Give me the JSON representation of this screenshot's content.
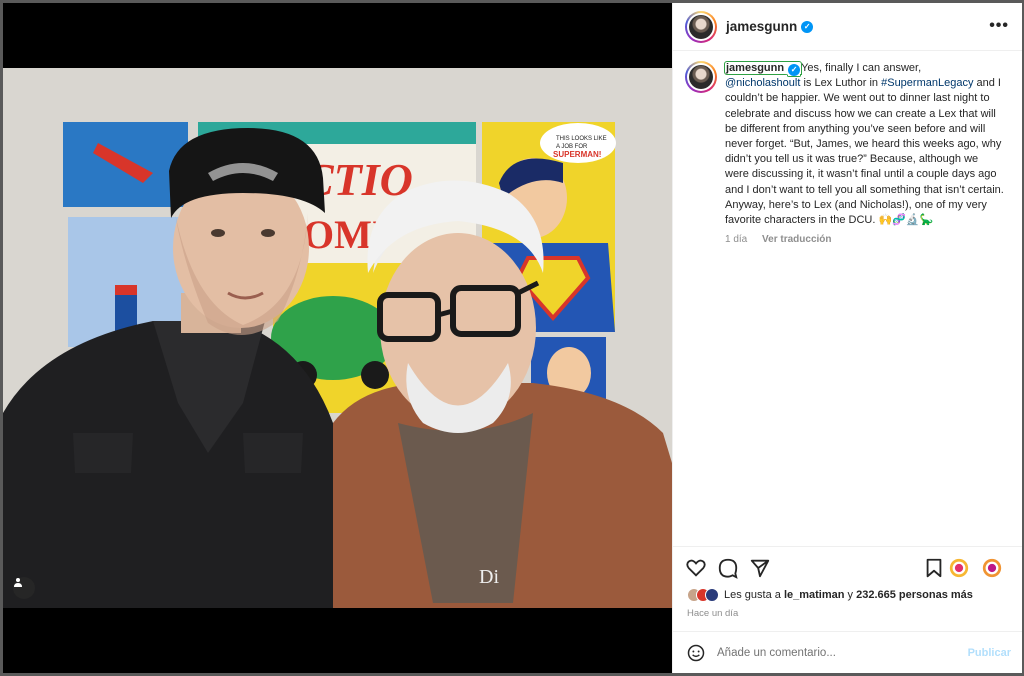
{
  "post": {
    "username": "jamesgunn",
    "verified_badge": "✓",
    "more_icon": "•••",
    "photo_letters": "Di"
  },
  "caption": {
    "username": "jamesgunn",
    "part1": "Yes, finally I can answer, ",
    "mention": "@nicholashoult",
    "part2": " is Lex Luthor in ",
    "hashtag": "#SupermanLegacy",
    "part3": " and I couldn’t be happier. We went out to dinner last night to celebrate and discuss how we can create a Lex that will be different from anything you’ve seen before and will never forget. “But, James, we heard this weeks ago, why didn’t you tell us it was true?” Because, although we were discussing it, it wasn’t final until a couple days ago and I don’t want to tell you all something that isn’t certain. Anyway, here’s to Lex (and Nicholas!), one of my very favorite characters in the DCU. ",
    "emojis": "🙌🧬🔬🦕",
    "age": "1 día",
    "translate": "Ver traducción"
  },
  "likes": {
    "prefix": "Les gusta a ",
    "user": "le_matiman",
    "middle": " y ",
    "count": "232.665 personas más"
  },
  "posted": "Hace un día",
  "comment": {
    "placeholder": "Añade un comentario...",
    "publish": "Publicar"
  },
  "colors": {
    "accent": "#0095f6",
    "link": "#00376b",
    "muted": "#8e8e8e"
  }
}
